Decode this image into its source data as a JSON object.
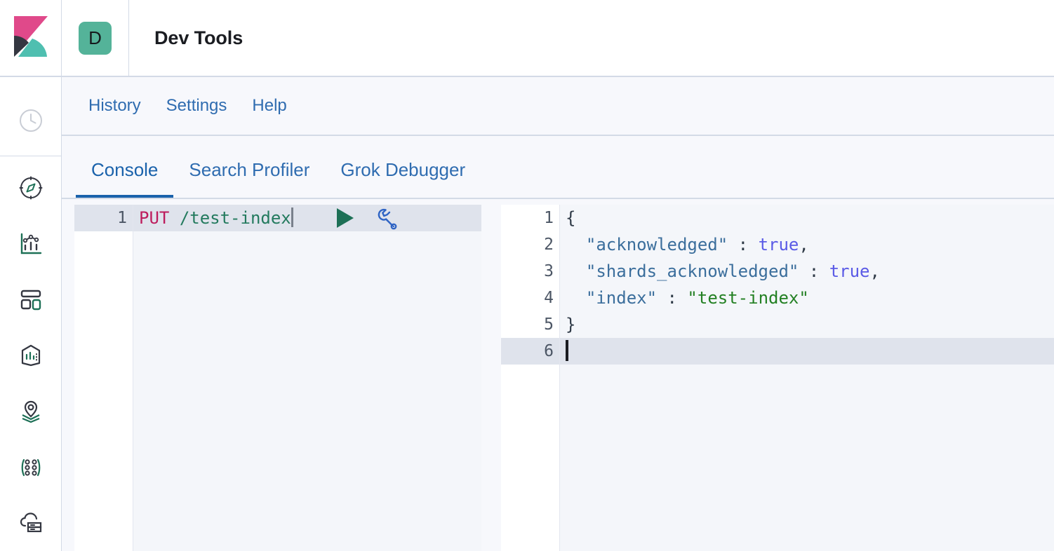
{
  "header": {
    "logo_icon": "kibana-logo",
    "app_badge_letter": "D",
    "app_badge_color": "#54b399",
    "title": "Dev Tools"
  },
  "rail": {
    "items": [
      {
        "icon": "recently-viewed-clock-icon",
        "label": "Recently viewed"
      },
      {
        "icon": "compass-discover-icon",
        "label": "Discover"
      },
      {
        "icon": "bar-chart-visualize-icon",
        "label": "Visualize"
      },
      {
        "icon": "dashboard-grid-icon",
        "label": "Dashboard"
      },
      {
        "icon": "canvas-frame-icon",
        "label": "Canvas"
      },
      {
        "icon": "maps-pin-layers-icon",
        "label": "Maps"
      },
      {
        "icon": "graph-nodes-icon",
        "label": "Graph"
      },
      {
        "icon": "machine-learning-cloud-icon",
        "label": "Machine Learning"
      }
    ]
  },
  "menu": {
    "items": [
      {
        "label": "History"
      },
      {
        "label": "Settings"
      },
      {
        "label": "Help"
      }
    ]
  },
  "tabs": {
    "items": [
      {
        "label": "Console",
        "active": true
      },
      {
        "label": "Search Profiler",
        "active": false
      },
      {
        "label": "Grok Debugger",
        "active": false
      }
    ]
  },
  "console": {
    "request": {
      "line_number": "1",
      "method": "PUT",
      "url": "/test-index",
      "play_icon": "play-triangle-icon",
      "wrench_icon": "wrench-icon"
    },
    "response": {
      "line_numbers": [
        "1",
        "2",
        "3",
        "4",
        "5",
        "6"
      ],
      "lines": [
        {
          "n": "1",
          "text": "{",
          "fold": "down",
          "active": false
        },
        {
          "n": "2",
          "text": "  \"acknowledged\" : true,",
          "fold": "",
          "active": false
        },
        {
          "n": "3",
          "text": "  \"shards_acknowledged\" : true,",
          "fold": "",
          "active": false
        },
        {
          "n": "4",
          "text": "  \"index\" : \"test-index\"",
          "fold": "",
          "active": false
        },
        {
          "n": "5",
          "text": "}",
          "fold": "up",
          "active": false
        },
        {
          "n": "6",
          "text": "",
          "fold": "",
          "active": true
        }
      ],
      "tokens": {
        "open_brace": "{",
        "close_brace": "}",
        "key_acknowledged": "\"acknowledged\"",
        "key_shards_acknowledged": "\"shards_acknowledged\"",
        "key_index": "\"index\"",
        "colon": " : ",
        "value_true": "true",
        "comma": ",",
        "value_index": "\"test-index\"",
        "indent": "  "
      }
    }
  },
  "colors": {
    "accent_link": "#2f6cb0",
    "tab_active": "#1a62ab",
    "badge_teal": "#54b399",
    "method_put": "#bd1c5d",
    "url_green": "#237a5e",
    "json_key": "#3b6e9c",
    "json_bool": "#5a5ae6",
    "json_string": "#238023",
    "active_line": "#dfe3ec"
  }
}
